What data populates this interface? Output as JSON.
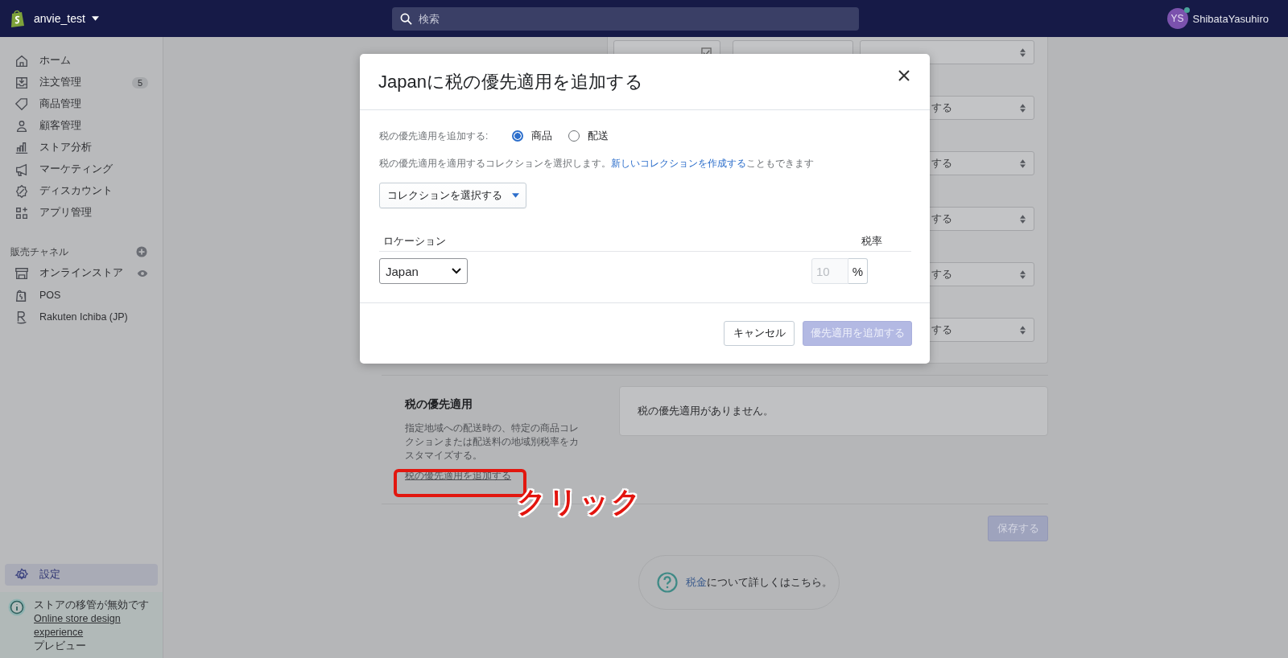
{
  "header": {
    "store": "anvie_test",
    "search": {
      "placeholder": "検索"
    },
    "user": {
      "initials": "YS",
      "name": "ShibataYasuhiro"
    }
  },
  "sidebar": {
    "items": [
      {
        "label": "ホーム",
        "kind": "home",
        "selected": false
      },
      {
        "label": "注文管理",
        "kind": "orders",
        "selected": false,
        "badge": "5"
      },
      {
        "label": "商品管理",
        "kind": "tag",
        "selected": false
      },
      {
        "label": "顧客管理",
        "kind": "person",
        "selected": false
      },
      {
        "label": "ストア分析",
        "kind": "chart",
        "selected": false
      },
      {
        "label": "マーケティング",
        "kind": "megaphone",
        "selected": false
      },
      {
        "label": "ディスカウント",
        "kind": "discount",
        "selected": false
      },
      {
        "label": "アプリ管理",
        "kind": "apps",
        "selected": false
      }
    ],
    "channels_title": "販売チャネル",
    "channels": [
      {
        "label": "オンラインストア",
        "kind": "store",
        "selected": false
      },
      {
        "label": "POS",
        "kind": "pos",
        "selected": false
      },
      {
        "label": "Rakuten Ichiba (JP)",
        "kind": "rakuten",
        "selected": false
      }
    ],
    "settings": {
      "label": "設定",
      "selected": true
    },
    "notice": {
      "text": "ストアの移管が無効です",
      "link": "Online store design experience",
      "suffix": "プレビュー"
    }
  },
  "tax_rows": [
    {
      "kind": "full"
    },
    {
      "kind": "partial",
      "option": "する"
    },
    {
      "kind": "partial",
      "option": "する"
    },
    {
      "kind": "partial",
      "option": "する"
    },
    {
      "kind": "partial",
      "option": "する"
    },
    {
      "kind": "partial",
      "option": "する"
    }
  ],
  "overrides": {
    "title": "税の優先適用",
    "description": "指定地域への配送時の、特定の商品コレクションまたは配送料の地域別税率をカスタマイズする。",
    "link": "税の優先適用を追加する",
    "empty": "税の優先適用がありません。"
  },
  "save_button": {
    "label": "保存する",
    "disabled": true
  },
  "help": {
    "link": "税金",
    "text": "について詳しくはこちら。"
  },
  "annotation": {
    "label": "クリック"
  },
  "modal": {
    "title": "Japanに税の優先適用を追加する",
    "apply_label": "税の優先適用を追加する:",
    "options": [
      {
        "label": "商品",
        "selected": true
      },
      {
        "label": "配送",
        "selected": false
      }
    ],
    "hint": "税の優先適用を適用するコレクションを選択します。",
    "hint_link": "新しいコレクションを作成する",
    "hint_suffix": "こともできます",
    "collection_button": "コレクションを選択する",
    "columns": [
      "ロケーション",
      "税率"
    ],
    "location": "Japan",
    "rate_placeholder": "10",
    "unit": "%",
    "cancel": "キャンセル",
    "submit": {
      "label": "優先適用を追加する",
      "disabled": true
    }
  }
}
